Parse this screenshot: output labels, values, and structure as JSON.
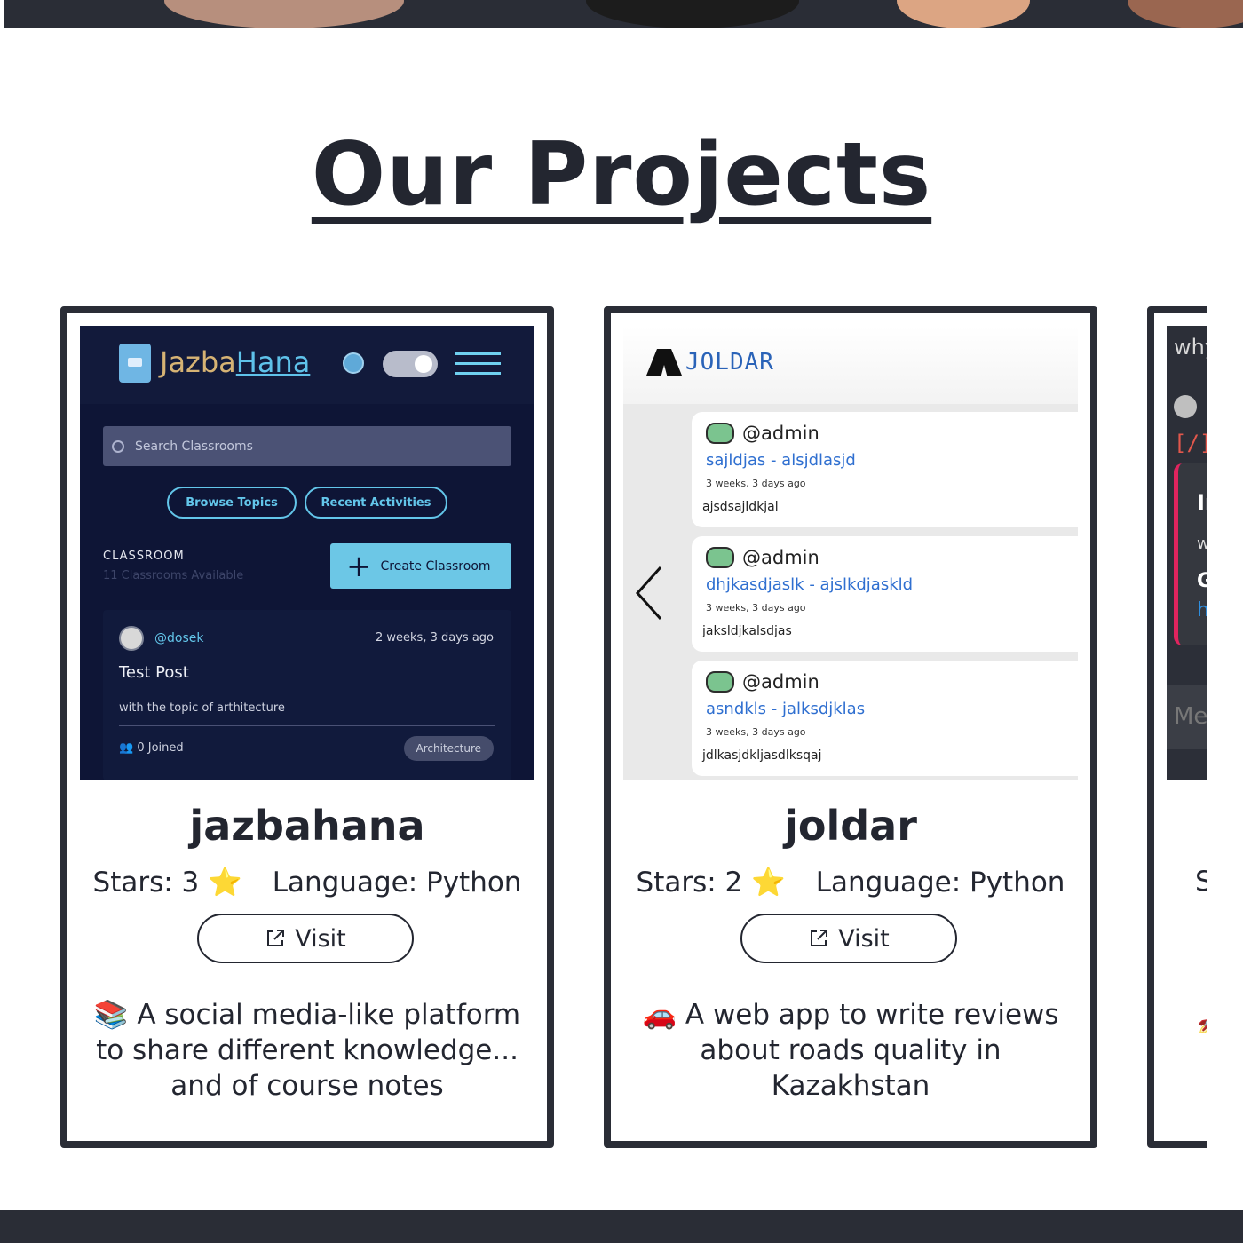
{
  "heading": "Our Projects",
  "projects": [
    {
      "name": "jazbahana",
      "stars_label": "Stars: 3 ⭐",
      "language_label": "Language: Python",
      "visit_label": "Visit",
      "description": "📚 A social media-like platform to share different knowledge... and of course notes",
      "screenshot": {
        "logo_part1": "Jazba",
        "logo_part2": "Hana",
        "search_placeholder": "Search Classrooms",
        "browse_label": "Browse Topics",
        "recent_label": "Recent Activities",
        "classroom_title": "CLASSROOM",
        "classroom_sub": "11 Classrooms Available",
        "create_label": "Create Classroom",
        "post": {
          "user": "@dosek",
          "time": "2 weeks, 3 days ago",
          "title": "Test Post",
          "description": "with the topic of arthitecture",
          "joined": "0 Joined",
          "tag": "Architecture"
        }
      }
    },
    {
      "name": "joldar",
      "stars_label": "Stars: 2 ⭐",
      "language_label": "Language: Python",
      "visit_label": "Visit",
      "description": "🚗 A web app to write reviews about roads quality in Kazakhstan",
      "screenshot": {
        "brand": "JOLDAR",
        "reviews": [
          {
            "user": "@admin",
            "title": "sajldjas - alsjdlasjd",
            "time": "3 weeks, 3 days ago",
            "body": "ajsdsajldkjal"
          },
          {
            "user": "@admin",
            "title": "dhjkasdjaslk - ajslkdjaskld",
            "time": "3 weeks, 3 days ago",
            "body": "jaksldjkalsdjas"
          },
          {
            "user": "@admin",
            "title": "asndkls - jalksdjklas",
            "time": "3 weeks, 3 days ago",
            "body": "jdlkasjdkljasdlksqaj"
          }
        ]
      }
    },
    {
      "name": "",
      "stars_label": "St",
      "screenshot": {
        "line1": "why",
        "bracket": "[/]",
        "b1": "In",
        "b2": "w",
        "b3": "G",
        "b4": "h",
        "msg": "Me"
      }
    }
  ],
  "colors": {
    "dark": "#2a2d36",
    "text": "#232630",
    "jazba_bg": "#0e1536",
    "jazba_accent": "#63c6ea",
    "joldar_link": "#2f6fd0"
  }
}
